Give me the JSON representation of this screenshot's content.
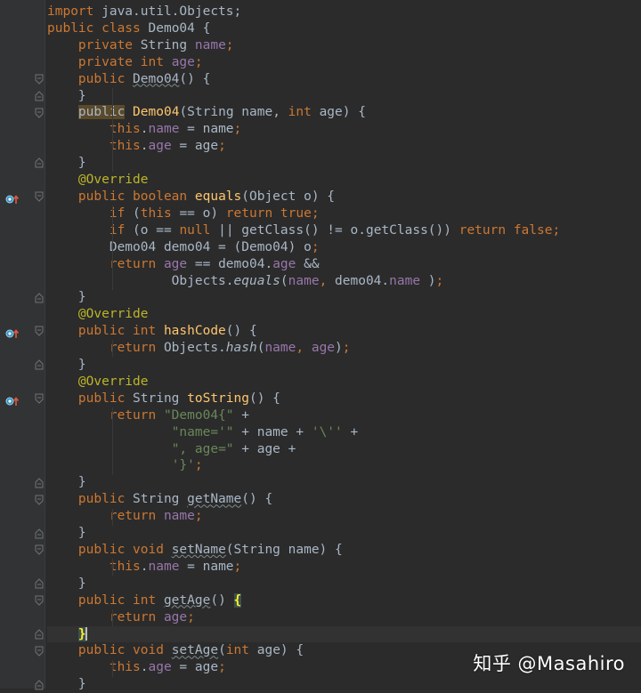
{
  "editor": {
    "language": "java",
    "lines": [
      [
        [
          "kw",
          "import "
        ],
        [
          "",
          "java.util.Objects;"
        ]
      ],
      [
        [
          "kw",
          "public class "
        ],
        [
          "",
          "Demo04 {"
        ]
      ],
      [
        [
          "",
          "    "
        ],
        [
          "kw",
          "private "
        ],
        [
          "",
          "String "
        ],
        [
          "fld",
          "name"
        ],
        [
          "kw",
          ";"
        ]
      ],
      [
        [
          "",
          "    "
        ],
        [
          "kw",
          "private int "
        ],
        [
          "fld",
          "age"
        ],
        [
          "kw",
          ";"
        ]
      ],
      [
        [
          "",
          "    "
        ],
        [
          "kw",
          "public "
        ],
        [
          "unused",
          "Demo04"
        ],
        [
          "",
          "() {"
        ]
      ],
      [
        [
          "",
          "    }"
        ]
      ],
      [
        [
          "",
          "    "
        ],
        [
          "hl-decl",
          "public"
        ],
        [
          "kw",
          " "
        ],
        [
          "mdecl",
          "Demo04"
        ],
        [
          "",
          "(String name, "
        ],
        [
          "kw",
          "int "
        ],
        [
          "",
          "age) {"
        ]
      ],
      [
        [
          "",
          "        "
        ],
        [
          "kw",
          "this"
        ],
        [
          "",
          "."
        ],
        [
          "fld",
          "name"
        ],
        [
          "",
          " = name"
        ],
        [
          "kw",
          ";"
        ]
      ],
      [
        [
          "",
          "        "
        ],
        [
          "kw",
          "this"
        ],
        [
          "",
          "."
        ],
        [
          "fld",
          "age"
        ],
        [
          "",
          " = age"
        ],
        [
          "kw",
          ";"
        ]
      ],
      [
        [
          "",
          "    }"
        ]
      ],
      [
        [
          "",
          "    "
        ],
        [
          "ann",
          "@Override"
        ]
      ],
      [
        [
          "",
          "    "
        ],
        [
          "kw",
          "public boolean "
        ],
        [
          "mdecl",
          "equals"
        ],
        [
          "",
          "(Object o) {"
        ]
      ],
      [
        [
          "",
          "        "
        ],
        [
          "kw",
          "if "
        ],
        [
          "",
          "("
        ],
        [
          "kw",
          "this "
        ],
        [
          "",
          "== o) "
        ],
        [
          "kw",
          "return true;"
        ]
      ],
      [
        [
          "",
          "        "
        ],
        [
          "kw",
          "if "
        ],
        [
          "",
          "(o == "
        ],
        [
          "kw",
          "null "
        ],
        [
          "",
          "|| getClass() != o.getClass()) "
        ],
        [
          "kw",
          "return false;"
        ]
      ],
      [
        [
          "",
          "        Demo04 demo04 = (Demo04) o"
        ],
        [
          "kw",
          ";"
        ]
      ],
      [
        [
          "",
          "        "
        ],
        [
          "kw",
          "return "
        ],
        [
          "fld",
          "age "
        ],
        [
          "",
          "== demo04."
        ],
        [
          "fld",
          "age "
        ],
        [
          "",
          "&&"
        ]
      ],
      [
        [
          "",
          "                Objects."
        ],
        [
          "ital",
          "equals"
        ],
        [
          "",
          "("
        ],
        [
          "fld",
          "name"
        ],
        [
          "kw",
          ", "
        ],
        [
          "",
          "demo04."
        ],
        [
          "fld",
          "name"
        ],
        [
          "",
          " )"
        ],
        [
          "kw",
          ";"
        ]
      ],
      [
        [
          "",
          "    }"
        ]
      ],
      [
        [
          "",
          "    "
        ],
        [
          "ann",
          "@Override"
        ]
      ],
      [
        [
          "",
          "    "
        ],
        [
          "kw",
          "public int "
        ],
        [
          "mdecl",
          "hashCode"
        ],
        [
          "",
          "() {"
        ]
      ],
      [
        [
          "",
          "        "
        ],
        [
          "kw",
          "return "
        ],
        [
          "",
          "Objects."
        ],
        [
          "ital",
          "hash"
        ],
        [
          "",
          "("
        ],
        [
          "fld",
          "name"
        ],
        [
          "kw",
          ", "
        ],
        [
          "fld",
          "age"
        ],
        [
          "",
          ")"
        ],
        [
          "kw",
          ";"
        ]
      ],
      [
        [
          "",
          "    }"
        ]
      ],
      [
        [
          "",
          "    "
        ],
        [
          "ann",
          "@Override"
        ]
      ],
      [
        [
          "",
          "    "
        ],
        [
          "kw",
          "public "
        ],
        [
          "",
          "String "
        ],
        [
          "mdecl",
          "toString"
        ],
        [
          "",
          "() {"
        ]
      ],
      [
        [
          "",
          "        "
        ],
        [
          "kw",
          "return "
        ],
        [
          "str",
          "\"Demo04{\" "
        ],
        [
          "",
          "+"
        ]
      ],
      [
        [
          "",
          "                "
        ],
        [
          "str",
          "\"name='\" "
        ],
        [
          "",
          "+ name + "
        ],
        [
          "str",
          "'\\'' "
        ],
        [
          "",
          "+"
        ]
      ],
      [
        [
          "",
          "                "
        ],
        [
          "str",
          "\", age=\" "
        ],
        [
          "",
          "+ age +"
        ]
      ],
      [
        [
          "",
          "                "
        ],
        [
          "str",
          "'}'"
        ],
        [
          "kw",
          ";"
        ]
      ],
      [
        [
          "",
          "    }"
        ]
      ],
      [
        [
          "",
          "    "
        ],
        [
          "kw",
          "public "
        ],
        [
          "",
          "String "
        ],
        [
          "unused",
          "getName"
        ],
        [
          "",
          "() {"
        ]
      ],
      [
        [
          "",
          "        "
        ],
        [
          "kw",
          "return "
        ],
        [
          "fld",
          "name"
        ],
        [
          "kw",
          ";"
        ]
      ],
      [
        [
          "",
          "    }"
        ]
      ],
      [
        [
          "",
          "    "
        ],
        [
          "kw",
          "public void "
        ],
        [
          "unused",
          "setName"
        ],
        [
          "",
          "(String name) {"
        ]
      ],
      [
        [
          "",
          "        "
        ],
        [
          "kw",
          "this"
        ],
        [
          "",
          "."
        ],
        [
          "fld",
          "name"
        ],
        [
          "",
          " = name"
        ],
        [
          "kw",
          ";"
        ]
      ],
      [
        [
          "",
          "    }"
        ]
      ],
      [
        [
          "",
          "    "
        ],
        [
          "kw",
          "public int "
        ],
        [
          "unused",
          "getAge"
        ],
        [
          "",
          "() "
        ],
        [
          "brace-match",
          "{"
        ]
      ],
      [
        [
          "",
          "        "
        ],
        [
          "kw",
          "return "
        ],
        [
          "fld",
          "age"
        ],
        [
          "kw",
          ";"
        ]
      ],
      [
        [
          "",
          "    "
        ],
        [
          "caret-brace",
          "}"
        ]
      ],
      [
        [
          "",
          "    "
        ],
        [
          "kw",
          "public void "
        ],
        [
          "unused",
          "setAge"
        ],
        [
          "",
          "("
        ],
        [
          "kw",
          "int "
        ],
        [
          "",
          "age) {"
        ]
      ],
      [
        [
          "",
          "        "
        ],
        [
          "kw",
          "this"
        ],
        [
          "",
          "."
        ],
        [
          "fld",
          "age"
        ],
        [
          "",
          " = age"
        ],
        [
          "kw",
          ";"
        ]
      ],
      [
        [
          "",
          "    }"
        ]
      ]
    ],
    "current_line": 37,
    "fold_markers": [
      {
        "line": 4,
        "kind": "start"
      },
      {
        "line": 5,
        "kind": "end"
      },
      {
        "line": 6,
        "kind": "start"
      },
      {
        "line": 9,
        "kind": "end"
      },
      {
        "line": 11,
        "kind": "start"
      },
      {
        "line": 17,
        "kind": "end"
      },
      {
        "line": 19,
        "kind": "start"
      },
      {
        "line": 21,
        "kind": "end"
      },
      {
        "line": 23,
        "kind": "start"
      },
      {
        "line": 28,
        "kind": "end"
      },
      {
        "line": 29,
        "kind": "start"
      },
      {
        "line": 31,
        "kind": "end"
      },
      {
        "line": 32,
        "kind": "start"
      },
      {
        "line": 34,
        "kind": "end"
      },
      {
        "line": 35,
        "kind": "start"
      },
      {
        "line": 37,
        "kind": "end"
      },
      {
        "line": 38,
        "kind": "start"
      },
      {
        "line": 40,
        "kind": "end"
      }
    ],
    "override_icon_lines": [
      11,
      19,
      23
    ],
    "icons": {
      "override": "override-method-icon",
      "fold": "fold-marker-icon"
    }
  },
  "watermark": {
    "text": "知乎 @Masahiro"
  },
  "colors": {
    "background": "#2b2b2b",
    "keyword": "#cc7832",
    "field": "#9876aa",
    "string": "#6a8759",
    "annotation": "#bbb529",
    "method_decl": "#ffc66d",
    "text": "#a9b7c6"
  }
}
